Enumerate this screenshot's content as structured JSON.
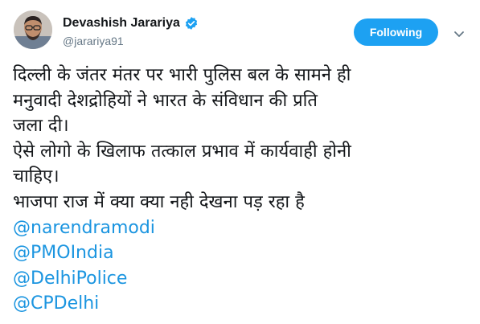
{
  "user": {
    "display_name": "Devashish Jarariya",
    "handle": "@jarariya91",
    "avatar_icon": "avatar-photo",
    "verified_icon": "verified-badge-icon"
  },
  "follow_button": {
    "label": "Following"
  },
  "menu": {
    "icon": "chevron-down-icon"
  },
  "tweet": {
    "lines": [
      "दिल्ली के जंतर मंतर पर भारी पुलिस बल के सामने ही",
      "मनुवादी देशद्रोहियों ने भारत के संविधान की प्रति",
      "जला दी।",
      "ऐसे लोगो के खिलाफ तत्काल प्रभाव में कार्यवाही होनी",
      "चाहिए।",
      "भाजपा राज में क्या क्या नही देखना पड़ रहा है"
    ],
    "mentions": [
      "@narendramodi",
      "@PMOIndia",
      "@DelhiPolice",
      "@CPDelhi"
    ]
  },
  "colors": {
    "accent": "#1da1f2",
    "mention": "#1b95e0",
    "text": "#14171a",
    "secondary": "#657786"
  }
}
